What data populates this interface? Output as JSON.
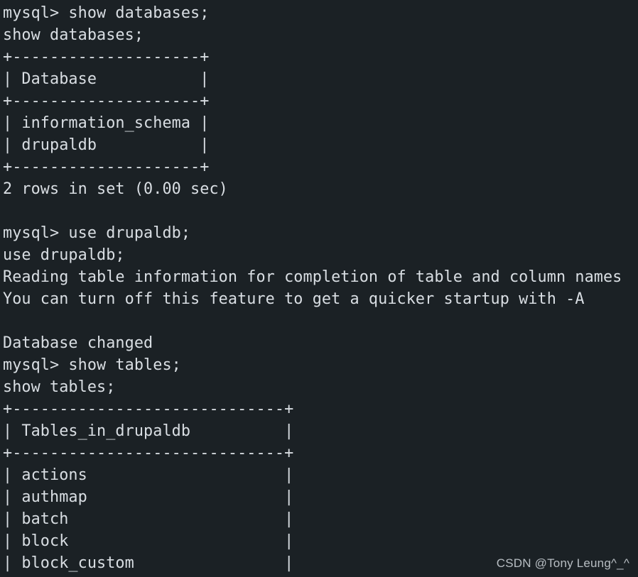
{
  "terminal": {
    "background_color": "#1b2125",
    "text_color": "#d9dee3",
    "prompt": "mysql>",
    "lines": [
      "mysql> show databases;",
      "show databases;",
      "+--------------------+",
      "| Database           |",
      "+--------------------+",
      "| information_schema |",
      "| drupaldb           |",
      "+--------------------+",
      "2 rows in set (0.00 sec)",
      "",
      "mysql> use drupaldb;",
      "use drupaldb;",
      "Reading table information for completion of table and column names",
      "You can turn off this feature to get a quicker startup with -A",
      "",
      "Database changed",
      "mysql> show tables;",
      "show tables;",
      "+-----------------------------+",
      "| Tables_in_drupaldb          |",
      "+-----------------------------+",
      "| actions                     |",
      "| authmap                     |",
      "| batch                       |",
      "| block                       |",
      "| block_custom                |"
    ],
    "commands": [
      "show databases;",
      "use drupaldb;",
      "show tables;"
    ],
    "results": {
      "databases": {
        "column_header": "Database",
        "rows": [
          "information_schema",
          "drupaldb"
        ],
        "row_count_text": "2 rows in set (0.00 sec)"
      },
      "messages": [
        "Reading table information for completion of table and column names",
        "You can turn off this feature to get a quicker startup with -A",
        "Database changed"
      ],
      "tables": {
        "column_header": "Tables_in_drupaldb",
        "rows": [
          "actions",
          "authmap",
          "batch",
          "block",
          "block_custom"
        ]
      }
    }
  },
  "watermark": {
    "text": "CSDN @Tony Leung^_^",
    "color": "#c3c9ce"
  }
}
